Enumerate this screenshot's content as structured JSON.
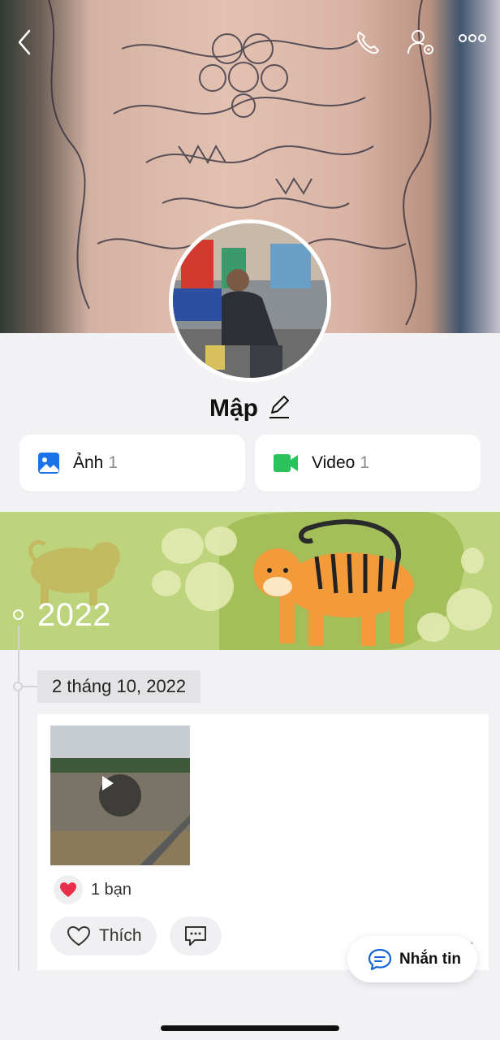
{
  "profile": {
    "name": "Mập"
  },
  "media": {
    "photo_label": "Ảnh",
    "photo_count": "1",
    "video_label": "Video",
    "video_count": "1"
  },
  "timeline": {
    "year": "2022",
    "date": "2 tháng 10, 2022"
  },
  "post": {
    "reaction_text": "1 bạn",
    "like_label": "Thích",
    "more_label": "..."
  },
  "chat": {
    "label": "Nhắn tin"
  },
  "icons": {
    "back": "chevron-left-icon",
    "phone": "phone-icon",
    "user_settings": "user-gear-icon",
    "more": "more-dots-icon",
    "edit": "pencil-icon",
    "photo": "image-icon",
    "video": "video-camera-icon",
    "play": "play-icon",
    "heart": "heart-icon",
    "like": "heart-outline-icon",
    "comment": "comment-icon",
    "chat": "chat-bubble-icon"
  },
  "colors": {
    "photo_icon": "#1a73e8",
    "video_icon": "#2bc25c",
    "heart": "#e8304a",
    "chat_icon": "#1565d8",
    "banner": "#bdd37c"
  }
}
